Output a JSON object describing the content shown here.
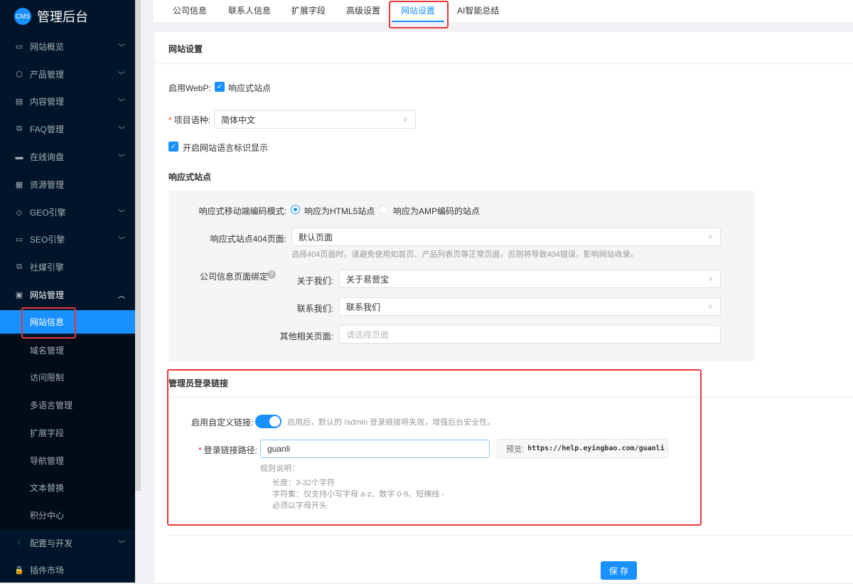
{
  "app": {
    "logo": "CMS",
    "title": "管理后台"
  },
  "sidebar": {
    "items": [
      {
        "label": "网站概览",
        "icon": "monitor-icon",
        "expandable": true
      },
      {
        "label": "产品管理",
        "icon": "box-icon",
        "expandable": true
      },
      {
        "label": "内容管理",
        "icon": "document-icon",
        "expandable": true
      },
      {
        "label": "FAQ管理",
        "icon": "faq-icon",
        "expandable": true
      },
      {
        "label": "在线询盘",
        "icon": "chat-icon",
        "expandable": true
      },
      {
        "label": "资源管理",
        "icon": "resource-icon",
        "expandable": false
      },
      {
        "label": "GEO引擎",
        "icon": "diamond-icon",
        "expandable": true
      },
      {
        "label": "SEO引擎",
        "icon": "seo-icon",
        "expandable": true
      },
      {
        "label": "社媒引擎",
        "icon": "social-icon",
        "expandable": false
      },
      {
        "label": "网站管理",
        "icon": "website-icon",
        "expandable": true
      }
    ],
    "sub_items": [
      "网站信息",
      "域名管理",
      "访问限制",
      "多语言管理",
      "扩展字段",
      "导航管理",
      "文本替换",
      "积分中心"
    ],
    "bottom_items": [
      {
        "label": "配置与开发",
        "icon": "sliders-icon"
      },
      {
        "label": "插件市场",
        "icon": "lock-icon"
      }
    ]
  },
  "tabs": [
    "公司信息",
    "联系人信息",
    "扩展字段",
    "高级设置",
    "网站设置",
    "AI智能总结"
  ],
  "active_tab": "网站设置",
  "card": {
    "title": "网站设置",
    "webp_label": "启用WebP:",
    "webp_option": "响应式站点",
    "lang_label": "项目语种:",
    "lang_value": "简体中文",
    "lang_flag": "开启网站语言标识显示",
    "responsive_heading": "响应式站点",
    "mode_label": "响应式移动端编码模式:",
    "mode_options": [
      "响应为HTML5站点",
      "响应为AMP编码的站点"
    ],
    "page404_label": "响应式站点404页面:",
    "page404_value": "默认页面",
    "page404_hint": "选择404页面时，请避免使用如首页、产品列表页等正常页面，否则将导致404错误，影响网站收录。",
    "bind_label": "公司信息页面绑定",
    "about_label": "关于我们:",
    "about_value": "关于易营宝",
    "contact_label": "联系我们:",
    "contact_value": "联系我们",
    "other_label": "其他相关页面:",
    "other_placeholder": "请选择页面",
    "admin_heading": "管理员登录链接",
    "custom_label": "启用自定义链接:",
    "custom_enabled": true,
    "custom_hint": "启用后，默认的 /admin 登录链接将失效，增强后台安全性。",
    "path_label": "登录链接路径:",
    "path_value": "guanli",
    "preview_label": "预览:",
    "preview_url": "https://help.eyingbao.com/guanli",
    "rules_title": "规则说明：",
    "rules": [
      "长度：3-32个字符",
      "字符集：仅支持小写字母 a-z、数字 0-9、短横线 -",
      "必须以字母开头"
    ],
    "save": "保 存"
  },
  "colors": {
    "primary": "#1890ff",
    "sidebar": "#001529",
    "highlight": "#e5393c"
  }
}
